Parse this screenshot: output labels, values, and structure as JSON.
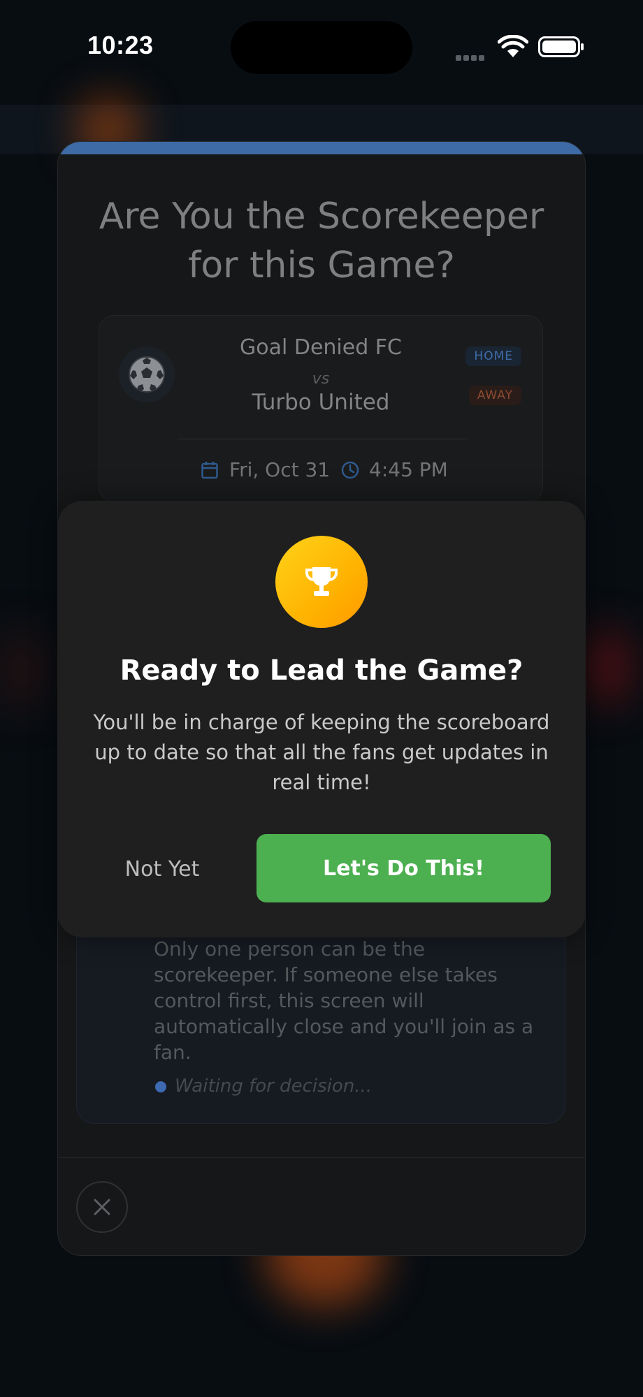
{
  "status_bar": {
    "time": "10:23"
  },
  "sheet": {
    "title_line1": "Are You the Scorekeeper",
    "title_line2": "for this Game?",
    "match": {
      "home_team": "Goal Denied FC",
      "vs": "vs",
      "away_team": "Turbo United",
      "home_badge": "HOME",
      "away_badge": "AWAY",
      "date": "Fri, Oct 31",
      "time": "4:45 PM"
    },
    "info": {
      "text": "Only one person can be the scorekeeper. If someone else takes control first, this screen will automatically close and you'll join as a fan.",
      "status": "Waiting for decision..."
    }
  },
  "modal": {
    "title": "Ready to Lead the Game?",
    "body": "You'll be in charge of keeping the scoreboard up to date so that all the fans get updates in real time!",
    "secondary_label": "Not Yet",
    "primary_label": "Let's Do This!"
  },
  "colors": {
    "accent_blue": "#3e6aa6",
    "primary_green": "#4caf50",
    "trophy_gold": "#ffc107"
  },
  "icons": [
    "soccer-ball-icon",
    "calendar-icon",
    "clock-icon",
    "close-icon",
    "trophy-icon",
    "wifi-icon",
    "battery-icon",
    "signal-icon"
  ]
}
